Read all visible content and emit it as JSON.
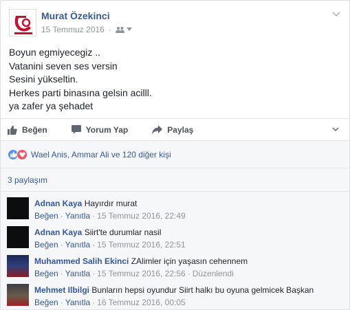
{
  "post": {
    "author": "Murat Özekinci",
    "date": "15 Temmuz 2016",
    "audience_icon": "friends-icon",
    "lines": [
      "Boyun egmiyecegiz ..",
      "Vatanini seven ses versin",
      "Sesini yükseltin.",
      "Herkes parti binasına gelsin acilll.",
      "ya zafer ya şehadet"
    ]
  },
  "actions": {
    "like": "Beğen",
    "comment": "Yorum Yap",
    "share": "Paylaş"
  },
  "reactions": {
    "text": "Wael Anis, Ammar Ali ve 120 diğer kişi"
  },
  "shares": {
    "text": "3 paylaşım"
  },
  "comment_actions": {
    "like": "Beğen",
    "reply": "Yanıtla"
  },
  "comments": [
    {
      "name": "Adnan Kaya",
      "text": "Hayırdır murat",
      "time": "15 Temmuz 2016, 22:49",
      "edited": ""
    },
    {
      "name": "Adnan Kaya",
      "text": "Siirt'te durumlar nasil",
      "time": "15 Temmuz 2016, 22:51",
      "edited": ""
    },
    {
      "name": "Muhammed Salih Ekinci",
      "text": "ZAlimler için yaşasın cehennem",
      "time": "15 Temmuz 2016, 22:56",
      "edited": "Düzenlendi"
    },
    {
      "name": "Mehmet Ilbilgi",
      "text": "Bunların hepsi oyundur Siirt halkı bu oyuna gelmicek Başkan",
      "time": "16 Temmuz 2016, 00:05",
      "edited": ""
    }
  ],
  "colors": {
    "link": "#365899",
    "meta": "#90949c",
    "like_reaction": "#5890ff",
    "love_reaction": "#f25268"
  }
}
